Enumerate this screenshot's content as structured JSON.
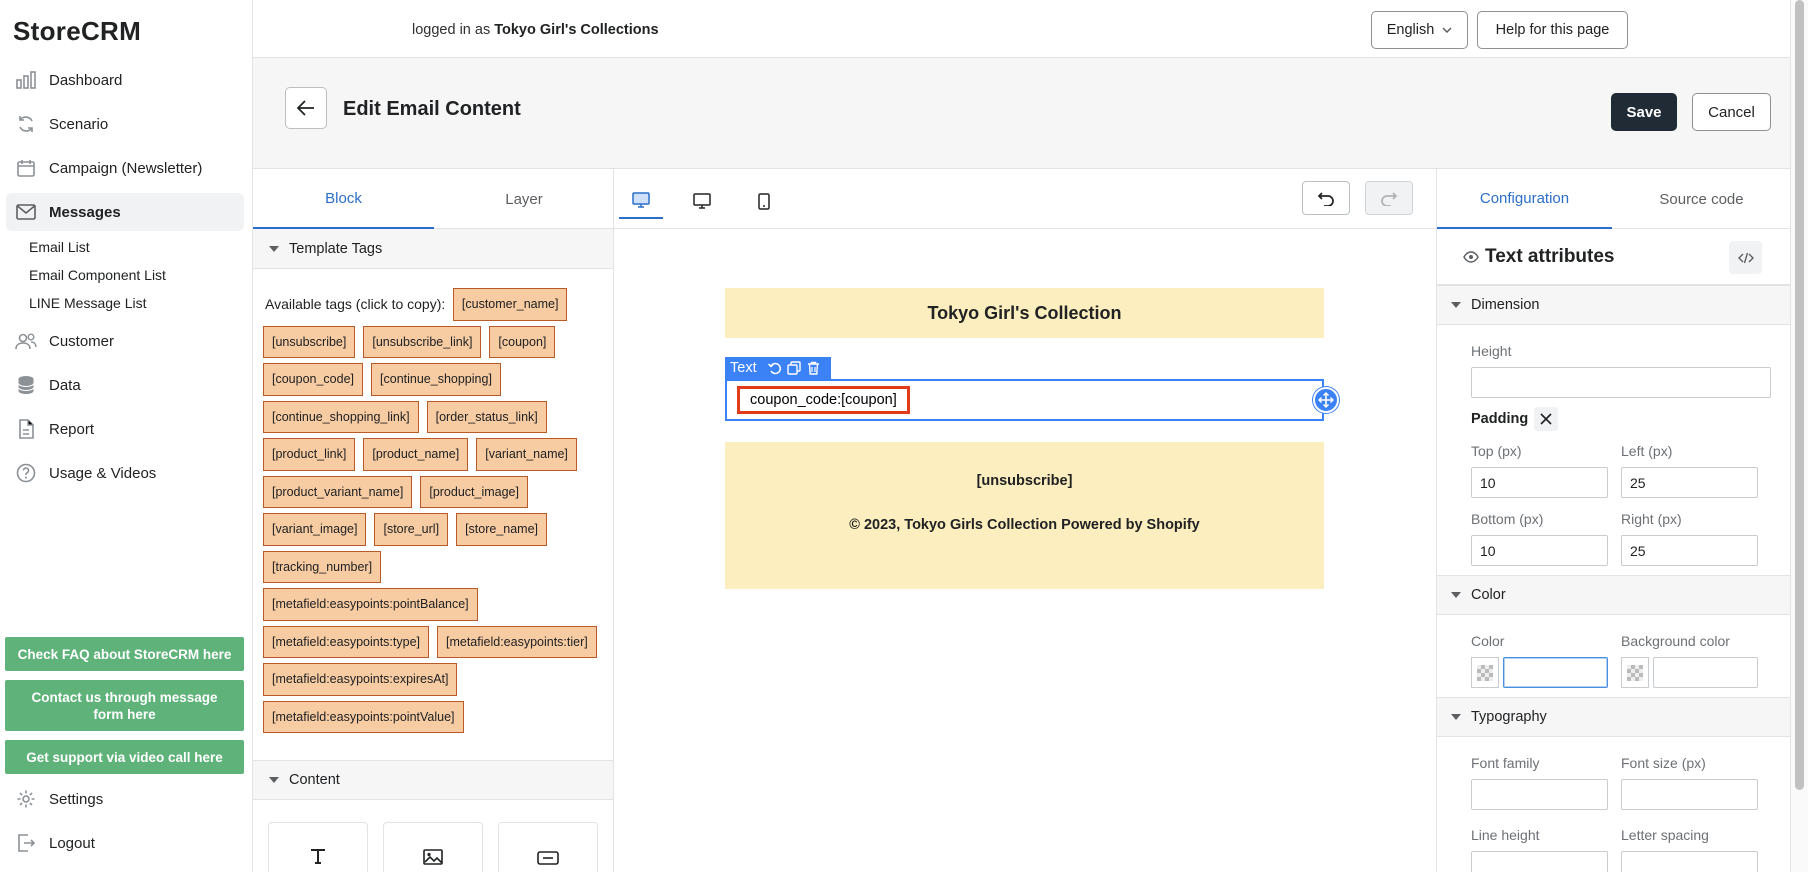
{
  "app": {
    "name": "StoreCRM"
  },
  "sidebar": {
    "items": [
      {
        "label": "Dashboard",
        "icon": "bar-chart-icon"
      },
      {
        "label": "Scenario",
        "icon": "refresh-icon"
      },
      {
        "label": "Campaign (Newsletter)",
        "icon": "calendar-icon"
      },
      {
        "label": "Messages",
        "icon": "envelope-icon"
      },
      {
        "label": "Customer",
        "icon": "people-icon"
      },
      {
        "label": "Data",
        "icon": "database-icon"
      },
      {
        "label": "Report",
        "icon": "document-icon"
      },
      {
        "label": "Usage & Videos",
        "icon": "help-circle-icon"
      }
    ],
    "sub_items": [
      "Email List",
      "Email Component List",
      "LINE Message List"
    ],
    "help_buttons": [
      "Check FAQ about StoreCRM here",
      "Contact us through message form here",
      "Get support via video call here"
    ],
    "bottom_items": [
      {
        "label": "Settings",
        "icon": "gear-icon"
      },
      {
        "label": "Logout",
        "icon": "logout-icon"
      }
    ]
  },
  "topbar": {
    "login_prefix": "logged in as ",
    "store_name": "Tokyo Girl's Collections",
    "language": "English",
    "help": "Help for this page"
  },
  "page": {
    "title": "Edit Email Content",
    "save": "Save",
    "cancel": "Cancel"
  },
  "left_panel": {
    "tabs": [
      "Block",
      "Layer"
    ],
    "active_tab": "Block",
    "template_tags_title": "Template Tags",
    "tags_intro": "Available tags (click to copy):",
    "tags": [
      "[customer_name]",
      "[unsubscribe]",
      "[unsubscribe_link]",
      "[coupon]",
      "[coupon_code]",
      "[continue_shopping]",
      "[continue_shopping_link]",
      "[order_status_link]",
      "[product_link]",
      "[product_name]",
      "[variant_name]",
      "[product_variant_name]",
      "[product_image]",
      "[variant_image]",
      "[store_url]",
      "[store_name]",
      "[tracking_number]",
      "[metafield:easypoints:pointBalance]",
      "[metafield:easypoints:type]",
      "[metafield:easypoints:tier]",
      "[metafield:easypoints:expiresAt]",
      "[metafield:easypoints:pointValue]"
    ],
    "content_title": "Content"
  },
  "canvas": {
    "header_text": "Tokyo Girl's Collection",
    "text_badge": "Text",
    "selected_text": "coupon_code:[coupon]",
    "footer_unsubscribe": "[unsubscribe]",
    "footer_copyright": "© 2023, Tokyo Girls Collection Powered by Shopify"
  },
  "right_panel": {
    "tabs": [
      "Configuration",
      "Source code"
    ],
    "active_tab": "Configuration",
    "attributes_title": "Text attributes",
    "dimension": {
      "title": "Dimension",
      "height_label": "Height",
      "height_value": "",
      "padding_label": "Padding",
      "top_label": "Top (px)",
      "top_value": "10",
      "left_label": "Left (px)",
      "left_value": "25",
      "bottom_label": "Bottom (px)",
      "bottom_value": "10",
      "right_label": "Right (px)",
      "right_value": "25"
    },
    "color": {
      "title": "Color",
      "color_label": "Color",
      "bg_label": "Background color"
    },
    "typography": {
      "title": "Typography",
      "font_family_label": "Font family",
      "font_size_label": "Font size (px)",
      "line_height_label": "Line height",
      "letter_spacing_label": "Letter spacing"
    }
  },
  "colors": {
    "accent": "#2c6ecb",
    "selection_blue": "#3b82f6",
    "tag_fill": "#f8cca3",
    "email_bg": "#fceebe",
    "help_green": "#5fb37a",
    "highlight_red": "#e23b1c",
    "save_dark": "#202b36"
  }
}
